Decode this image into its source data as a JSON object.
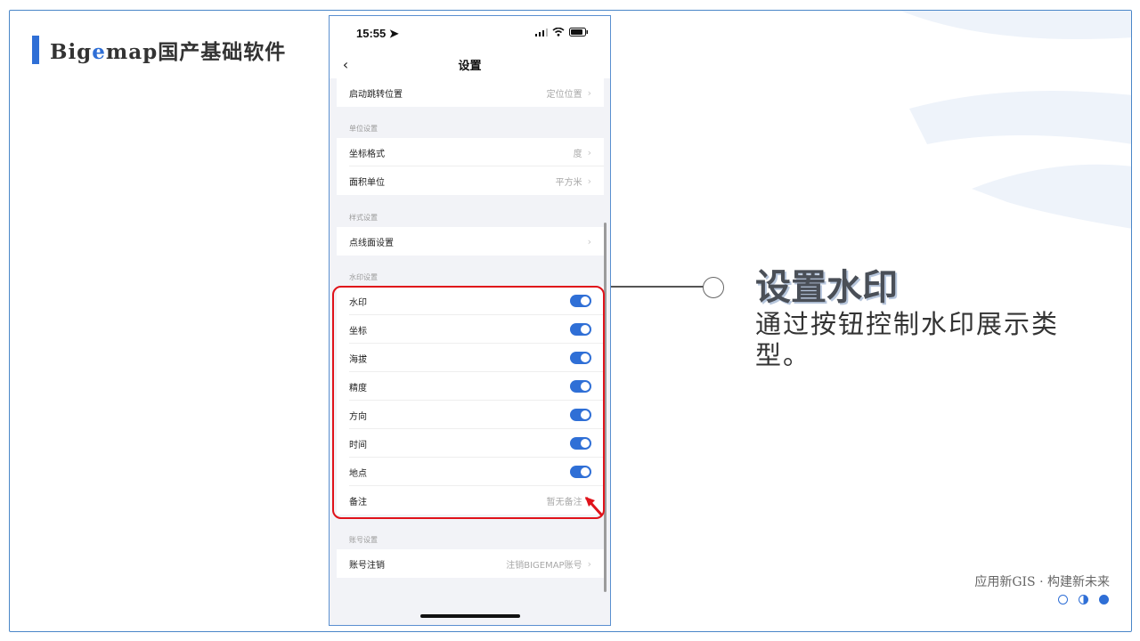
{
  "brand": {
    "part1": "Big",
    "part2": "e",
    "part3": "map国产基础软件"
  },
  "phone": {
    "status_time": "15:55",
    "nav_title": "设置",
    "rows_top": [
      {
        "label": "启动跳转位置",
        "value": "定位位置"
      }
    ],
    "sections": {
      "unit": "单位设置",
      "style": "样式设置",
      "watermark": "水印设置",
      "account": "账号设置"
    },
    "unit_rows": [
      {
        "label": "坐标格式",
        "value": "度"
      },
      {
        "label": "面积单位",
        "value": "平方米"
      }
    ],
    "style_rows": [
      {
        "label": "点线面设置",
        "value": ""
      }
    ],
    "watermark_rows": [
      {
        "label": "水印",
        "on": true
      },
      {
        "label": "坐标",
        "on": true
      },
      {
        "label": "海拔",
        "on": true
      },
      {
        "label": "精度",
        "on": true
      },
      {
        "label": "方向",
        "on": true
      },
      {
        "label": "时间",
        "on": true
      },
      {
        "label": "地点",
        "on": true
      }
    ],
    "note_row": {
      "label": "备注",
      "value": "暂无备注"
    },
    "account_rows": [
      {
        "label": "账号注销",
        "value": "注销BIGEMAP账号"
      }
    ]
  },
  "callout": {
    "title": "设置水印",
    "desc": "通过按钮控制水印展示类型。"
  },
  "footer": {
    "slogan": "应用新GIS · 构建新未来"
  },
  "colors": {
    "accent": "#2f6fd6",
    "highlight": "#e0121a"
  }
}
